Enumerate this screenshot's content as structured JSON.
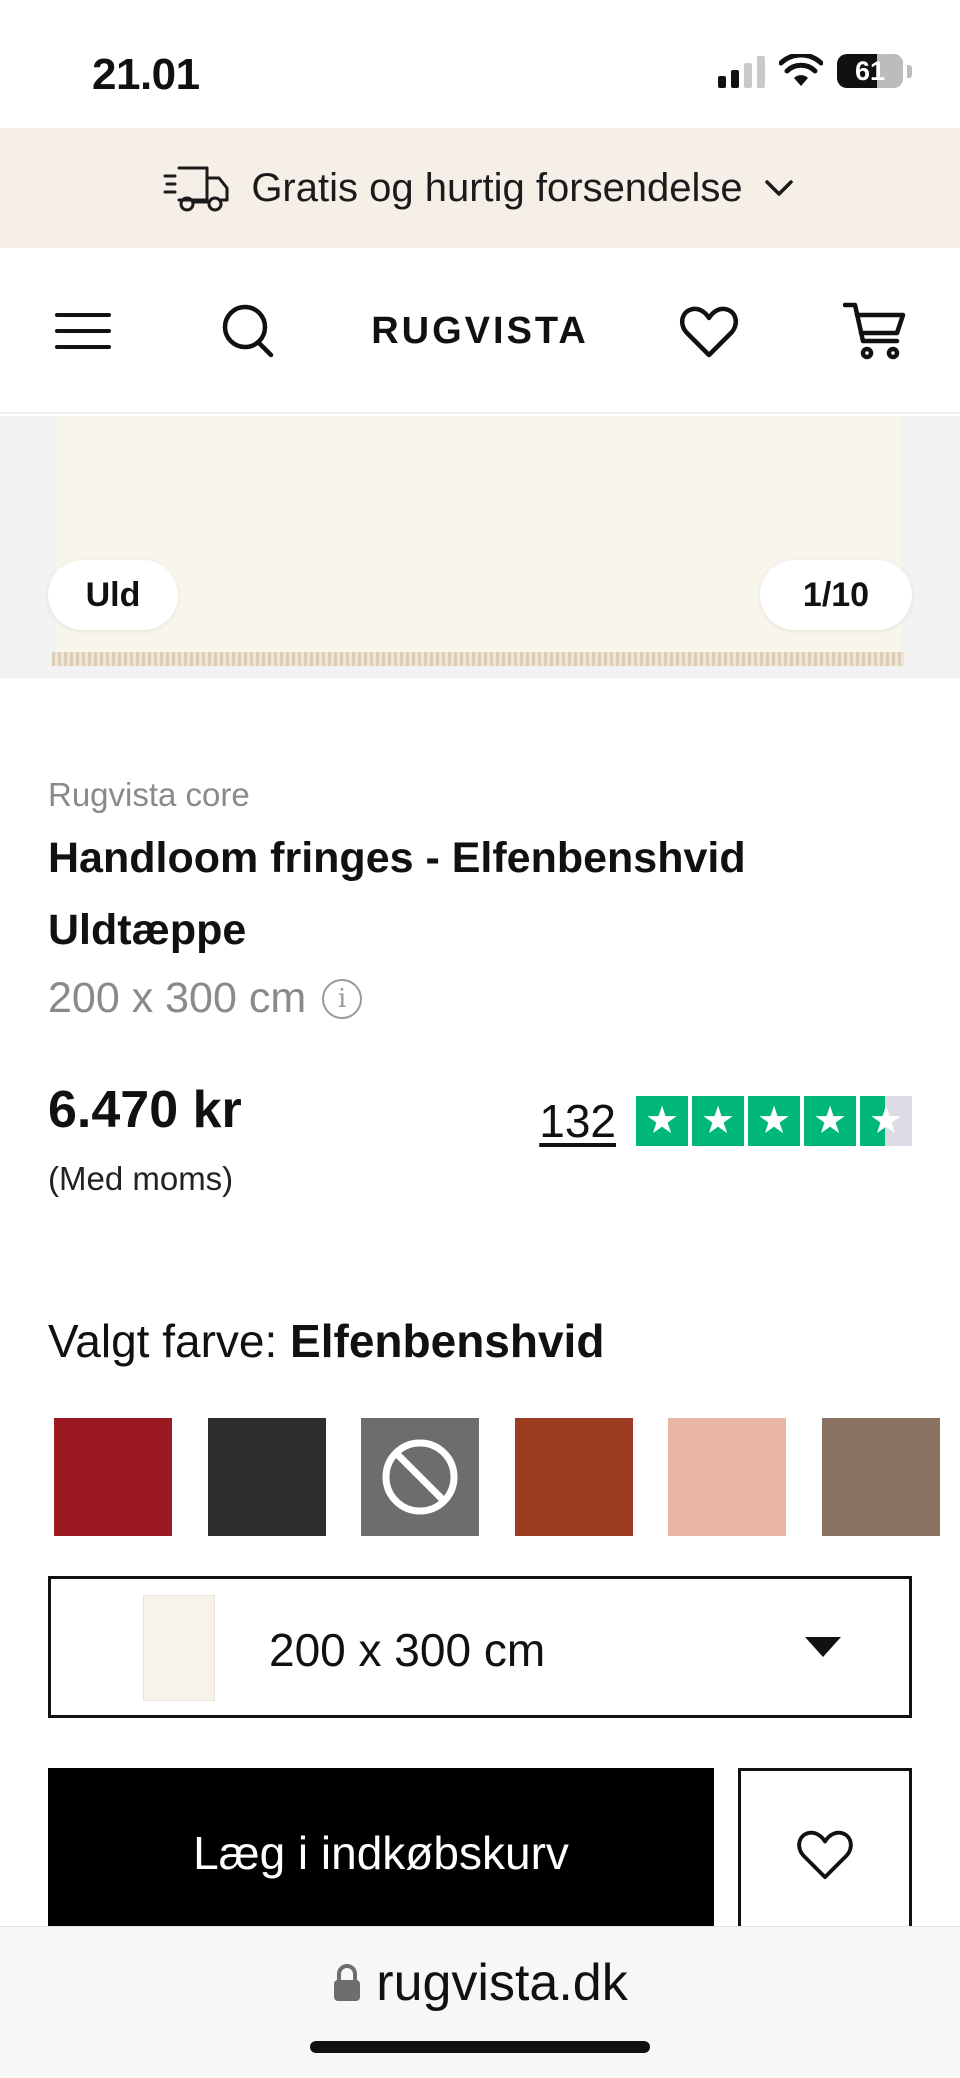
{
  "status_bar": {
    "time": "21.01",
    "battery": "61"
  },
  "promo": {
    "text": "Gratis og hurtig forsendelse"
  },
  "header": {
    "logo": "RUGVISTA"
  },
  "gallery": {
    "material_tag": "Uld",
    "counter": "1/10"
  },
  "product": {
    "brand": "Rugvista core",
    "title": "Handloom fringes - Elfenbenshvid Uldtæppe",
    "size": "200 x 300 cm",
    "info_icon": "i",
    "price": "6.470 kr",
    "vat_note": "(Med moms)",
    "review_count": "132",
    "rating_stars": 4.5,
    "rating_color": "#00b67a"
  },
  "color_selection": {
    "label": "Valgt farve:",
    "selected": "Elfenbenshvid",
    "swatches": [
      {
        "name": "red",
        "color": "#9b1a22"
      },
      {
        "name": "charcoal",
        "color": "#2c2f2d"
      },
      {
        "name": "grey-unavailable",
        "color": "#6c6e6d",
        "unavailable": true
      },
      {
        "name": "rust",
        "color": "#9c3a22"
      },
      {
        "name": "blush",
        "color": "#e9b6a4"
      },
      {
        "name": "brown",
        "color": "#8a7262"
      }
    ]
  },
  "size_select": {
    "value": "200 x 300 cm"
  },
  "actions": {
    "add_to_cart": "Læg i indkøbskurv"
  },
  "browser": {
    "url": "rugvista.dk"
  }
}
